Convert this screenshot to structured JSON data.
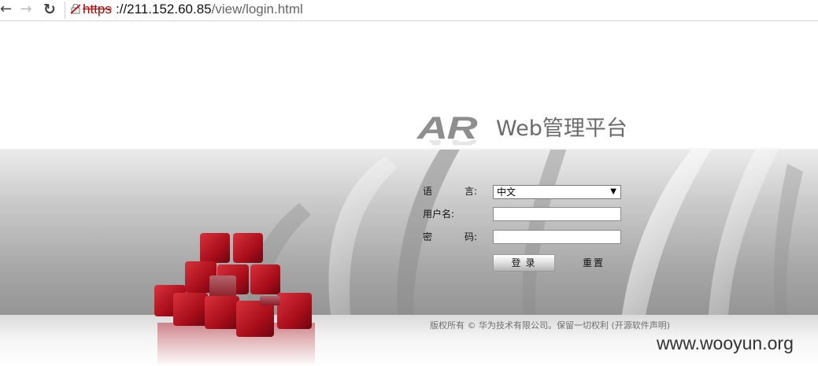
{
  "browser": {
    "url_scheme": "https",
    "url_host": "://211.152.60.85",
    "url_path": "/view/login.html",
    "icons": [
      "back-arrow-icon",
      "forward-arrow-icon",
      "reload-icon",
      "broken-lock-icon"
    ]
  },
  "logo": {
    "mark": "AR",
    "title": "Web管理平台"
  },
  "form": {
    "language_label_left": "语",
    "language_label_right": "言:",
    "language_value": "中文",
    "username_label": "用户名:",
    "username_value": "",
    "password_label_left": "密",
    "password_label_right": "码:",
    "password_value": "",
    "login_button": "登录",
    "reset_button": "重置"
  },
  "footer": {
    "copyright": "版权所有 © 华为技术有限公司。保留一切权利 (开源软件声明)"
  },
  "watermark": "www.wooyun.org",
  "colors": {
    "cube_red": "#b0101c",
    "insecure_scheme": "#c00000"
  }
}
